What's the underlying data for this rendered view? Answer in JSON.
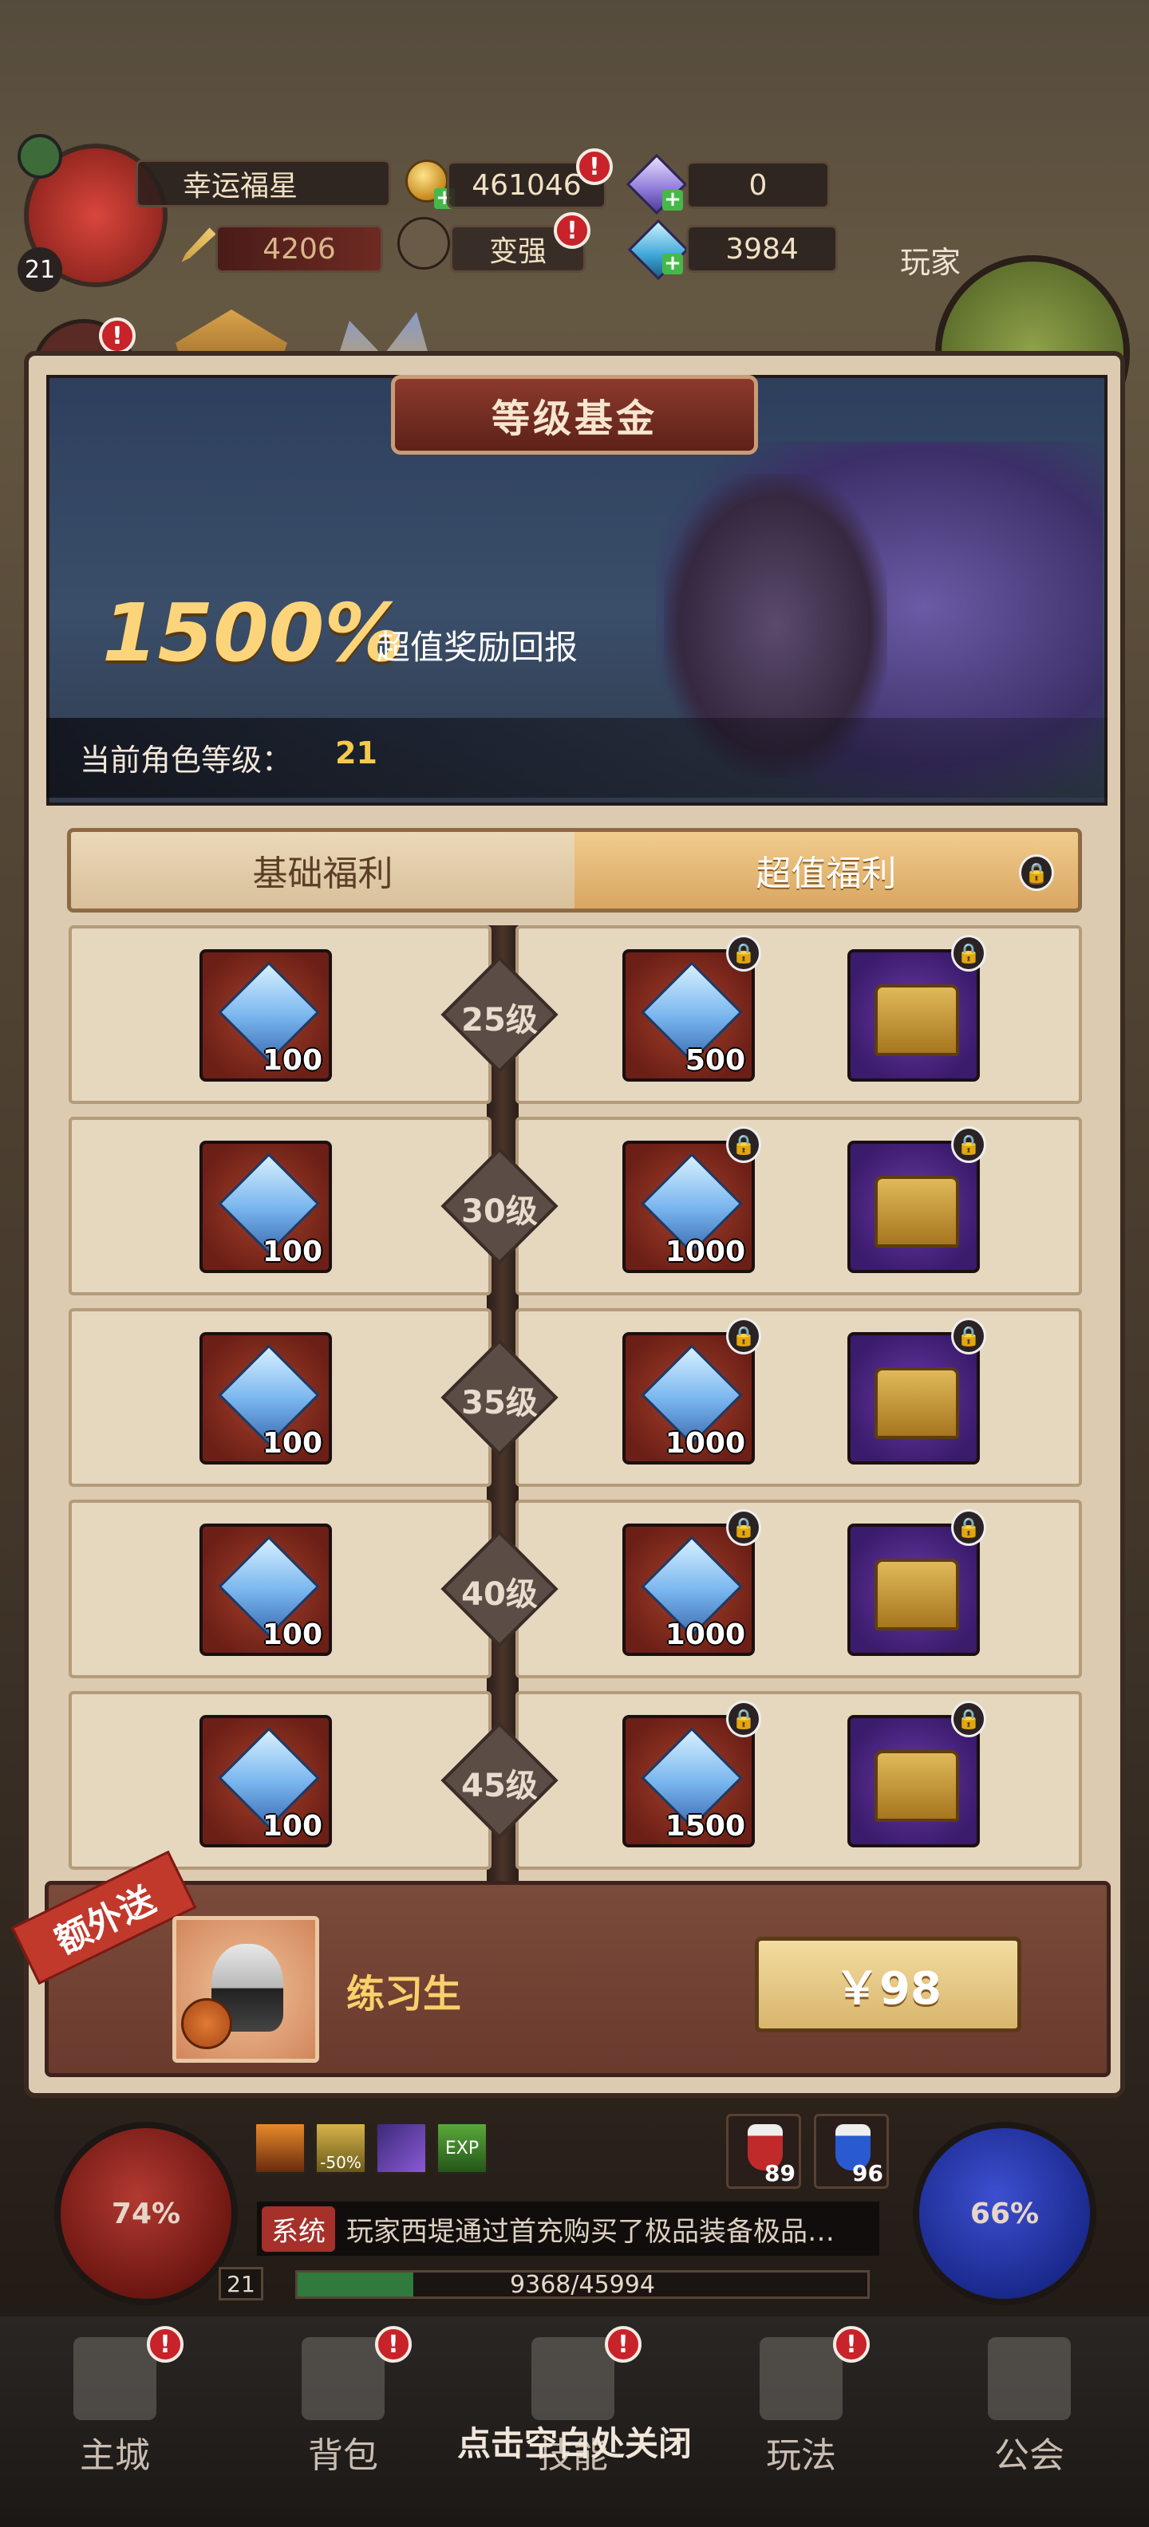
{
  "player": {
    "name": "幸运福星",
    "level": "21",
    "power": "4206",
    "strengthen_label": "变强",
    "side_label": "玩家"
  },
  "currency": {
    "gold": "461046",
    "diamond": "0",
    "crystal": "3984"
  },
  "banner": {
    "title": "等级基金",
    "percent": "1500%",
    "subtitle": "超值奖励回报",
    "level_label": "当前角色等级：",
    "level_value": "21"
  },
  "tabs": [
    {
      "label": "基础福利"
    },
    {
      "label": "超值福利"
    }
  ],
  "rewards": [
    {
      "level": "25级",
      "basic_qty": "100",
      "premium_qty": "500"
    },
    {
      "level": "30级",
      "basic_qty": "100",
      "premium_qty": "1000"
    },
    {
      "level": "35级",
      "basic_qty": "100",
      "premium_qty": "1000"
    },
    {
      "level": "40级",
      "basic_qty": "100",
      "premium_qty": "1000"
    },
    {
      "level": "45级",
      "basic_qty": "100",
      "premium_qty": "1500"
    }
  ],
  "purchase": {
    "ribbon": "额外送",
    "character": "练习生",
    "price": "￥98"
  },
  "hud": {
    "hp_percent": "74%",
    "mp_percent": "66%",
    "level_small": "21",
    "potion_red": "89",
    "potion_blue": "96",
    "buff_discount": "-50%",
    "buff_exp": "EXP",
    "system_tag": "系统",
    "system_msg": "玩家西堤通过首充购买了极品装备极品…",
    "xp_text": "9368/45994",
    "xp_fraction": 0.2035
  },
  "nav": [
    {
      "label": "主城"
    },
    {
      "label": "背包"
    },
    {
      "label": "技能"
    },
    {
      "label": "玩法"
    },
    {
      "label": "公会"
    }
  ],
  "close_hint": "点击空白处关闭",
  "colors": {
    "accent_gold": "#fcd57a",
    "alert_red": "#c8222a",
    "tab_active": "#d9a662"
  }
}
